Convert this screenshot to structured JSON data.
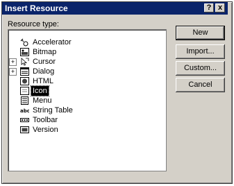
{
  "window": {
    "title": "Insert Resource",
    "help_label": "?",
    "close_label": "x"
  },
  "list": {
    "label": "Resource type:",
    "items": [
      {
        "name": "Accelerator",
        "icon": "accelerator-icon"
      },
      {
        "name": "Bitmap",
        "icon": "bitmap-icon"
      },
      {
        "name": "Cursor",
        "icon": "cursor-icon"
      },
      {
        "name": "Dialog",
        "icon": "dialog-icon"
      },
      {
        "name": "HTML",
        "icon": "html-icon"
      },
      {
        "name": "Icon",
        "icon": "icon-resource-icon"
      },
      {
        "name": "Menu",
        "icon": "menu-icon"
      },
      {
        "name": "String Table",
        "icon": "string-table-icon"
      },
      {
        "name": "Toolbar",
        "icon": "toolbar-icon"
      },
      {
        "name": "Version",
        "icon": "version-icon"
      }
    ]
  },
  "buttons": {
    "new": "New",
    "import": "Import...",
    "custom": "Custom...",
    "cancel": "Cancel"
  }
}
